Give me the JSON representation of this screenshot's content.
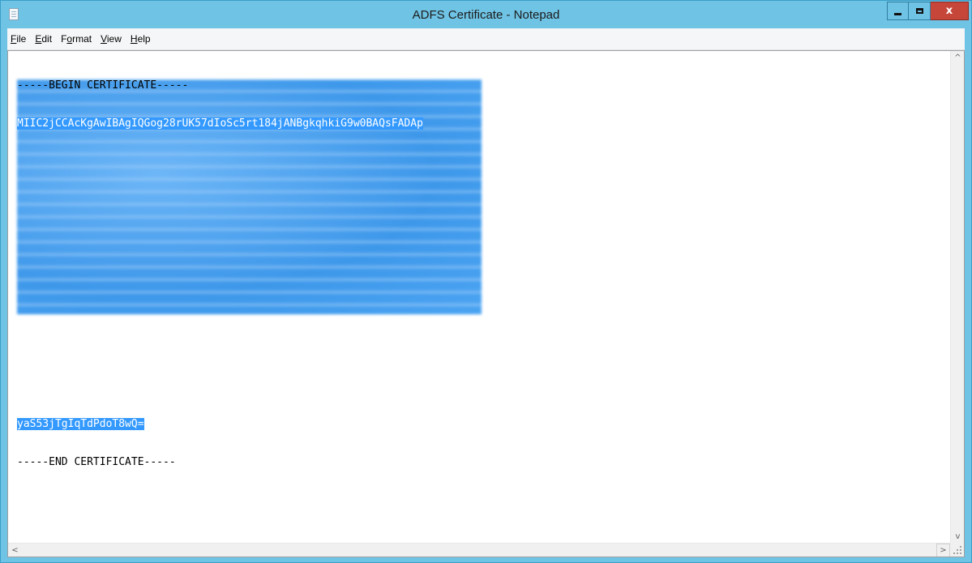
{
  "window": {
    "title": "ADFS Certificate - Notepad",
    "close_glyph": "x"
  },
  "menu": [
    {
      "accel": "F",
      "rest": "ile"
    },
    {
      "accel": "E",
      "rest": "dit"
    },
    {
      "pre": "F",
      "accel": "o",
      "rest": "rmat"
    },
    {
      "accel": "V",
      "rest": "iew"
    },
    {
      "accel": "H",
      "rest": "elp"
    }
  ],
  "document": {
    "begin_line": "-----BEGIN CERTIFICATE-----",
    "first_cert_line": "MIIC2jCCAcKgAwIBAgIQGog28rUK57dIoSc5rt184jANBgkqhkiG9w0BAQsFADAp",
    "last_cert_line": "yaS53jTgIqTdPdoT8wQ=",
    "end_line": "-----END CERTIFICATE-----"
  },
  "scrollbars": {
    "up": "^",
    "down": "v",
    "left": "<",
    "right": ">"
  },
  "colors": {
    "titlebar": "#6fc3e4",
    "selection": "#3399ff",
    "close_button": "#c7463a"
  }
}
